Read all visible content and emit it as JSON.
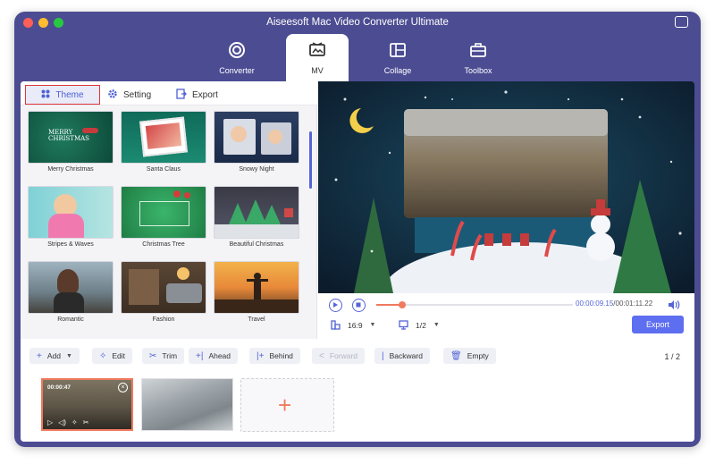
{
  "window": {
    "title": "Aiseesoft Mac Video Converter Ultimate"
  },
  "nav": {
    "tabs": [
      {
        "label": "Converter"
      },
      {
        "label": "MV"
      },
      {
        "label": "Collage"
      },
      {
        "label": "Toolbox"
      }
    ],
    "active": "MV"
  },
  "subtabs": {
    "theme": "Theme",
    "setting": "Setting",
    "export": "Export"
  },
  "themes": [
    {
      "label": "Merry Christmas"
    },
    {
      "label": "Santa Claus"
    },
    {
      "label": "Snowy Night"
    },
    {
      "label": "Stripes & Waves"
    },
    {
      "label": "Christmas Tree"
    },
    {
      "label": "Beautiful Christmas"
    },
    {
      "label": "Romantic"
    },
    {
      "label": "Fashion"
    },
    {
      "label": "Travel"
    }
  ],
  "player": {
    "current_time": "00:00:09.15",
    "total_time": "/00:01:11.22",
    "progress": 0.13,
    "aspect_ratio": "16:9",
    "zoom": "1/2",
    "export_label": "Export"
  },
  "toolbar": {
    "add": "Add",
    "edit": "Edit",
    "trim": "Trim",
    "ahead": "Ahead",
    "behind": "Behind",
    "forward": "Forward",
    "backward": "Backward",
    "empty": "Empty",
    "page": "1 / 2"
  },
  "timeline": {
    "clips": [
      {
        "duration": "00:00:47"
      },
      {
        "duration": ""
      }
    ],
    "add_icon": "plus-icon"
  },
  "colors": {
    "accent": "#5e6ef0",
    "highlight": "#f07a5e",
    "window": "#4c4c93"
  }
}
